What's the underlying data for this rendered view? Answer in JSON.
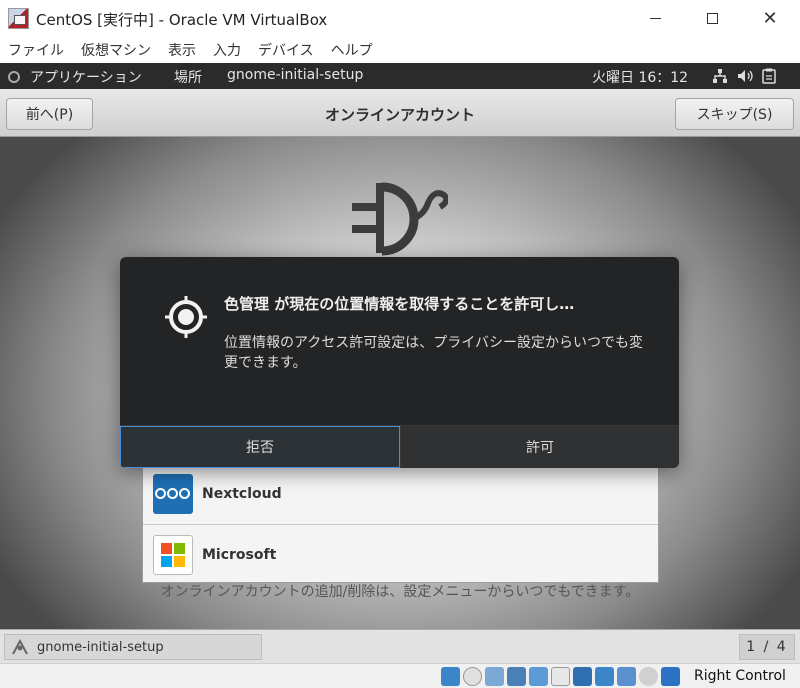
{
  "window": {
    "title": "CentOS [実行中] - Oracle VM VirtualBox",
    "controls": {
      "minimize_icon": "minimize-icon",
      "maximize_icon": "maximize-icon",
      "close_icon": "close-icon"
    }
  },
  "menubar": {
    "items": [
      "ファイル",
      "仮想マシン",
      "表示",
      "入力",
      "デバイス",
      "ヘルプ"
    ]
  },
  "gnome_top": {
    "activities": "アプリケーション",
    "places": "場所",
    "app_name": "gnome-initial-setup",
    "clock": "火曜日 16：12",
    "status_icons": [
      "network-icon",
      "volume-icon",
      "clipboard-icon"
    ]
  },
  "headerbar": {
    "prev_label": "前へ(P)",
    "title": "オンラインアカウント",
    "skip_label": "スキップ(S)"
  },
  "accounts": [
    {
      "name": "Nextcloud",
      "icon": "nextcloud-icon"
    },
    {
      "name": "Microsoft",
      "icon": "microsoft-icon"
    }
  ],
  "footer_note": "オンラインアカウントの追加/削除は、設定メニューからいつでもできます。",
  "dialog": {
    "title": "色管理 が現在の位置情報を取得することを許可し…",
    "body": "位置情報のアクセス許可設定は、プライバシー設定からいつでも変更できます。",
    "deny_label": "拒否",
    "allow_label": "許可",
    "icon": "location-icon"
  },
  "gnome_bottom": {
    "task_label": "gnome-initial-setup",
    "workspace": "1 / 4"
  },
  "statusbar": {
    "host_key": "Right Control"
  },
  "colors": {
    "dialog_bg": "#232425",
    "focus_border": "#4a90d9",
    "top_bar": "#2b2b2b"
  }
}
